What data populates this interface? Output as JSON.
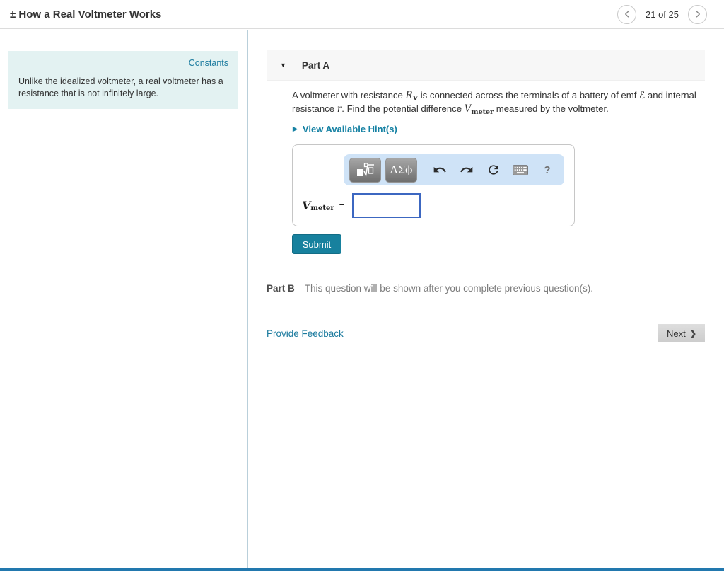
{
  "header": {
    "title": "± How a Real Voltmeter Works",
    "pager": {
      "position_label": "21 of 25"
    }
  },
  "sidebar": {
    "constants_link": "Constants",
    "intro_text": "Unlike the idealized voltmeter, a real voltmeter has a resistance that is not infinitely large."
  },
  "part_a": {
    "collapse_icon": "▼",
    "title": "Part A",
    "problem": {
      "seg1": "A voltmeter with resistance ",
      "rv_base": "R",
      "rv_sub": "V",
      "seg2": " is connected across the terminals of a battery of emf ",
      "emf_symbol": "ℰ",
      "seg3": " and internal resistance ",
      "r_symbol": "r",
      "seg4": ". Find the potential difference ",
      "v_base": "V",
      "v_sub": "meter",
      "seg5": " measured by the voltmeter."
    },
    "hint": {
      "expand_icon": "▶",
      "label": "View Available Hint(s)"
    },
    "toolbar": {
      "templates_button": "equation-templates",
      "greek_button_label": "ΑΣϕ",
      "help_label": "?"
    },
    "answer": {
      "var_base": "V",
      "var_sub": "meter",
      "equals": "=",
      "input_value": ""
    },
    "submit_label": "Submit"
  },
  "part_b": {
    "title": "Part B",
    "message": "This question will be shown after you complete previous question(s)."
  },
  "footer": {
    "feedback_link": "Provide Feedback",
    "next_label": "Next",
    "next_chevron": "❯"
  },
  "colors": {
    "accent_teal": "#17819e",
    "link_teal": "#1a7a9e",
    "toolbar_blue": "#cfe3f7",
    "info_box_bg": "#e3f2f2",
    "input_border_blue": "#3c67c1",
    "bottom_bar_blue": "#2278ae"
  }
}
